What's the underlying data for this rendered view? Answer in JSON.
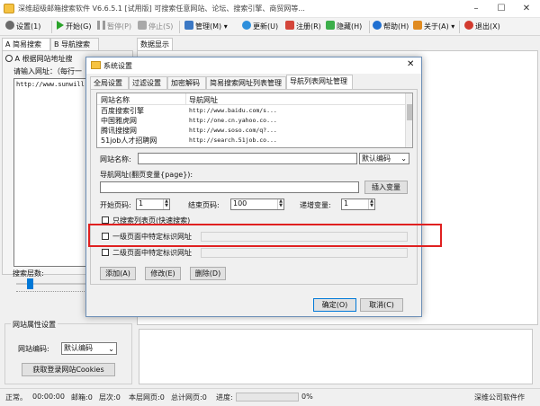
{
  "window": {
    "title": "深维超级邮箱搜索软件 V6.6.5.1 [试用版] 可搜索任意网站、论坛、搜索引擎、商贸网等..."
  },
  "toolbar": {
    "settings": "设置(1)",
    "start": "开始(G)",
    "pause": "暂停(P)",
    "stop": "停止(S)",
    "manage": "管理(M)",
    "update": "更新(U)",
    "register": "注册(R)",
    "hide": "隐藏(H)",
    "help": "帮助(H)",
    "about": "关于(A)",
    "exit": "退出(X)"
  },
  "left_panel": {
    "tabs": [
      "A 简易搜索",
      "B 导航搜索"
    ],
    "radio_label": "A 根据网站地址搜",
    "url_label": "请输入网址：（每行一",
    "url_value": "http://www.sunwill",
    "depth_label": "搜索层数:"
  },
  "data_tab": "数据显示",
  "site_props": {
    "title": "网站属性设置",
    "encoding_label": "网站编码:",
    "encoding_value": "默认编码",
    "cookies_button": "获取登录网站Cookies"
  },
  "dialog": {
    "title": "系统设置",
    "tabs": [
      "全局设置",
      "过滤设置",
      "加密解码",
      "简易搜索网址列表管理",
      "导航列表网址管理"
    ],
    "active_tab_index": 4,
    "list": {
      "headers": [
        "网站名称",
        "导航网址"
      ],
      "rows": [
        {
          "name": "百度搜索引擎",
          "url": "http://www.baidu.com/s..."
        },
        {
          "name": "中国雅虎网",
          "url": "http://one.cn.yahoo.co..."
        },
        {
          "name": "腾讯搜搜网",
          "url": "http://www.soso.com/q?..."
        },
        {
          "name": "51job人才招聘网",
          "url": "http://search.51job.co..."
        }
      ]
    },
    "site_name_label": "网站名称:",
    "site_name_value": "",
    "encoding_value": "默认编码",
    "nav_url_label": "导航网址(翻页变量{page}):",
    "nav_url_value": "",
    "insert_var_button": "插入变量",
    "start_page_label": "开始页码:",
    "start_page_value": "1",
    "end_page_label": "结束页码:",
    "end_page_value": "100",
    "step_label": "递增变量:",
    "step_value": "1",
    "only_list_label": "只搜索列表页(快速搜索)",
    "level1_label": "一级页面中特定标识网址",
    "level2_label": "二级页面中特定标识网址",
    "add_button": "添加(A)",
    "modify_button": "修改(E)",
    "delete_button": "删除(D)",
    "ok_button": "确定(O)",
    "cancel_button": "取消(C)"
  },
  "status_bar": {
    "normal": "正常。",
    "time": "00:00:00",
    "emails": "邮箱:0",
    "level": "层次:0",
    "page": "本层网页:0",
    "total": "总计网页:0",
    "progress_label": "进度:",
    "progress_pct": "0%",
    "company": "深维公司软件作"
  },
  "colors": {
    "accent": "#0078d7",
    "highlight_box": "#e02020",
    "dialog_border": "#6d8fb7"
  }
}
